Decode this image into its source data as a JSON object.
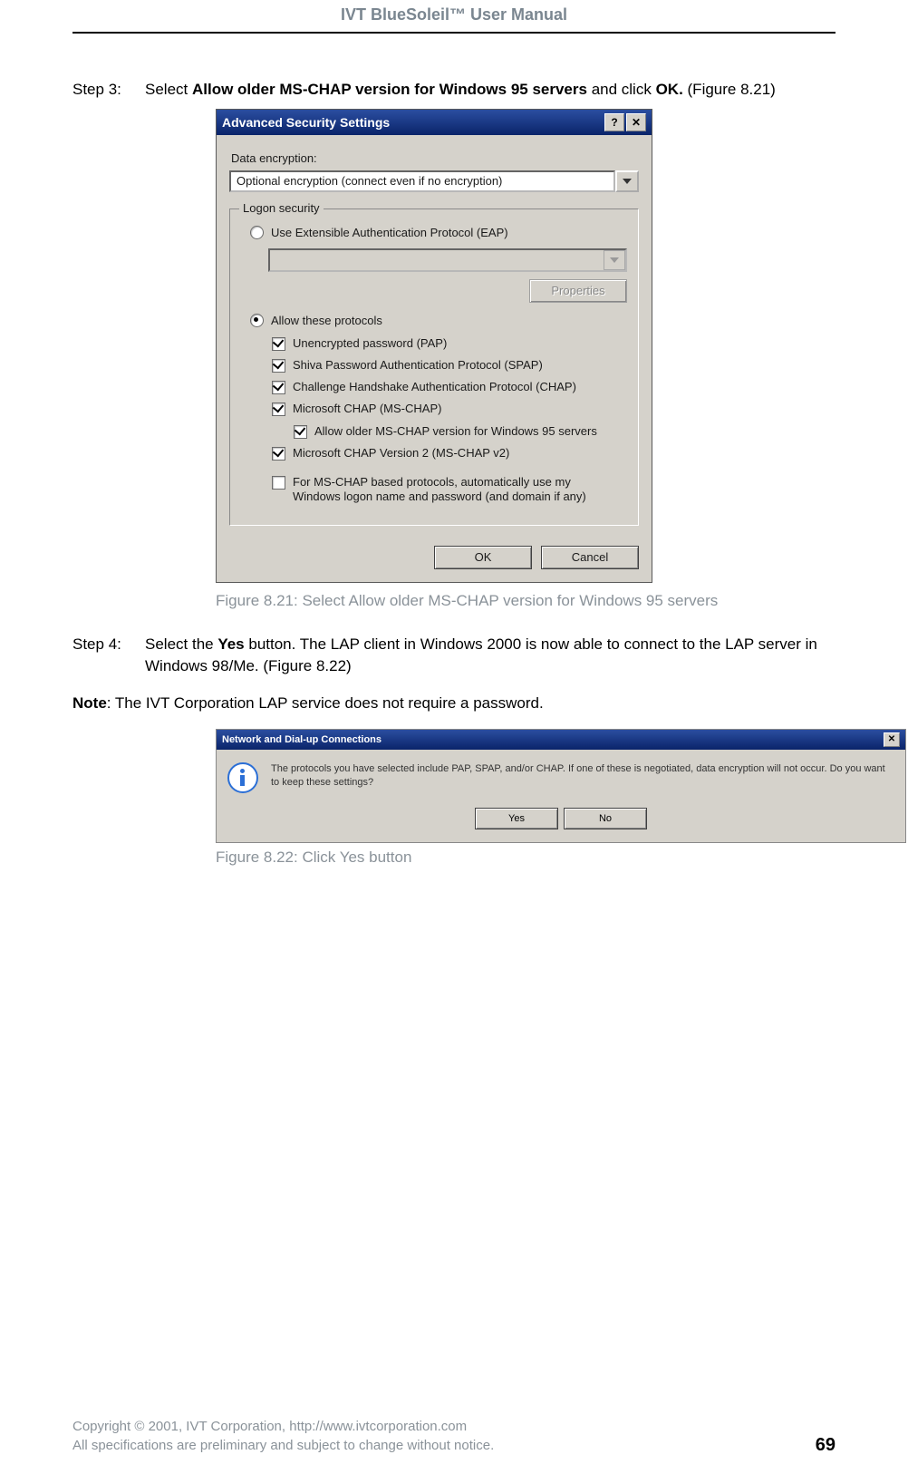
{
  "header_title": "IVT BlueSoleil™ User Manual",
  "step3": {
    "label": "Step 3:",
    "pre": "Select ",
    "bold1": "Allow older MS-CHAP version for Windows 95 servers",
    "mid": " and click ",
    "bold2": "OK.",
    "post": " (Figure 8.21)"
  },
  "dlg821": {
    "title": "Advanced Security Settings",
    "data_enc_label": "Data encryption:",
    "data_enc_value": "Optional encryption (connect even if no encryption)",
    "fieldset_legend": "Logon security",
    "radio_eap": "Use Extensible Authentication Protocol (EAP)",
    "properties_btn": "Properties",
    "radio_allow": "Allow these protocols",
    "chk_pap": "Unencrypted password (PAP)",
    "chk_spap": "Shiva Password Authentication Protocol (SPAP)",
    "chk_chap": "Challenge Handshake Authentication Protocol (CHAP)",
    "chk_mschap": "Microsoft CHAP (MS-CHAP)",
    "chk_mschap_old": "Allow older MS-CHAP version for Windows 95 servers",
    "chk_mschap2": "Microsoft CHAP Version 2 (MS-CHAP v2)",
    "chk_autologon": "For MS-CHAP based protocols, automatically use my Windows logon name and password (and domain if any)",
    "ok_btn": "OK",
    "cancel_btn": "Cancel"
  },
  "caption821": "Figure 8.21: Select Allow older MS-CHAP version for Windows 95 servers",
  "step4": {
    "label": "Step 4:",
    "pre": "Select the ",
    "bold": "Yes",
    "post": " button. The LAP client in Windows 2000 is now able to connect to the LAP server in Windows 98/Me. (Figure 8.22)"
  },
  "note": {
    "label": "Note",
    "text": ": The IVT Corporation LAP service does not require a password."
  },
  "dlg822": {
    "title": "Network and Dial-up Connections",
    "body": "The protocols you have selected include PAP, SPAP, and/or CHAP.  If one of these is negotiated, data encryption will not occur.  Do you want to keep these settings?",
    "yes_btn": "Yes",
    "no_btn": "No"
  },
  "caption822": "Figure 8.22: Click Yes button",
  "footer": {
    "line1": "Copyright © 2001, IVT Corporation, http://www.ivtcorporation.com",
    "line2": "All specifications are preliminary and subject to change without notice.",
    "page_no": "69"
  }
}
